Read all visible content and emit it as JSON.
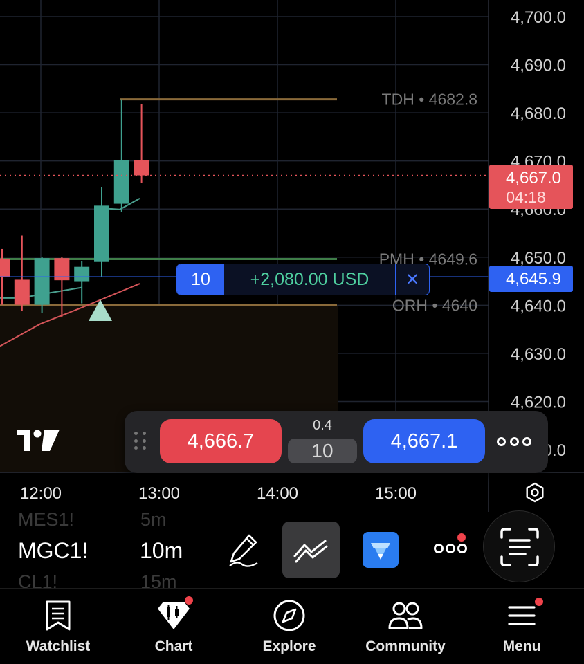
{
  "chart_data": {
    "type": "candlestick",
    "x_ticks": [
      "12:00",
      "13:00",
      "14:00",
      "15:00"
    ],
    "y_ticks": [
      "4,700.0",
      "4,690.0",
      "4,680.0",
      "4,670.0",
      "4,660.0",
      "4,650.0",
      "4,640.0",
      "4,630.0",
      "4,620.0",
      "4,610.0"
    ],
    "ylim": [
      4610,
      4700
    ],
    "candles": [
      {
        "o": 4649.7,
        "h": 4651.7,
        "l": 4640.1,
        "c": 4645.9
      },
      {
        "o": 4645.3,
        "h": 4654.5,
        "l": 4638.8,
        "c": 4640.1
      },
      {
        "o": 4640.1,
        "h": 4650.1,
        "l": 4638.4,
        "c": 4649.8
      },
      {
        "o": 4649.8,
        "h": 4650.1,
        "l": 4637.5,
        "c": 4645.2
      },
      {
        "o": 4645.0,
        "h": 4649.2,
        "l": 4640.4,
        "c": 4648.0
      },
      {
        "o": 4649.0,
        "h": 4664.5,
        "l": 4646.0,
        "c": 4660.7
      },
      {
        "o": 4661.1,
        "h": 4682.8,
        "l": 4659.4,
        "c": 4670.2
      },
      {
        "o": 4670.2,
        "h": 4681.8,
        "l": 4665.5,
        "c": 4667.0
      }
    ],
    "ma_fast": [
      4660.2,
      4659.9,
      4662.2
    ],
    "ma_slow": [
      4631.5,
      4636.1,
      4639.5,
      4644.5
    ],
    "levels": [
      {
        "label": "TDH • 4682.8",
        "value": 4682.8,
        "color": "#8a6a3a"
      },
      {
        "label": "PMH • 4649.6",
        "value": 4649.6,
        "color": "#3f7d48"
      },
      {
        "label": "ORH • 4640",
        "value": 4640,
        "color": "#8a6a3a"
      }
    ],
    "last_price": {
      "value": "4,667.0",
      "countdown": "04:18",
      "color": "#e5545a"
    },
    "position_price": {
      "value": "4,645.9",
      "color": "#2e62f2"
    }
  },
  "position": {
    "qty": "10",
    "pnl": "+2,080.00 USD",
    "close_symbol": "✕"
  },
  "order_bar": {
    "sell_price": "4,666.7",
    "buy_price": "4,667.1",
    "spread": "0.4",
    "quantity": "10"
  },
  "toolbar": {
    "symbol": "MGC1!",
    "symbol_prev": "MES1!",
    "symbol_next": "CL1!",
    "interval": "10m",
    "interval_prev": "5m",
    "interval_next": "15m"
  },
  "tabs": [
    {
      "label": "Watchlist",
      "icon": "bookmark-icon"
    },
    {
      "label": "Chart",
      "icon": "chart-icon"
    },
    {
      "label": "Explore",
      "icon": "compass-icon"
    },
    {
      "label": "Community",
      "icon": "people-icon"
    },
    {
      "label": "Menu",
      "icon": "hamburger-icon"
    }
  ],
  "colors": {
    "up": "#3fa18f",
    "down": "#e5545a",
    "grid": "#1f2430",
    "accent": "#2e62f2"
  }
}
